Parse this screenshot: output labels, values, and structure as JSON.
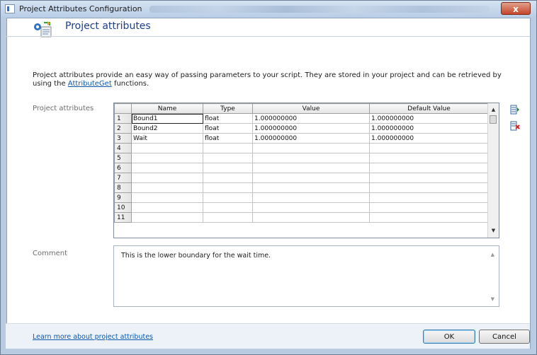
{
  "window": {
    "title": "Project Attributes Configuration",
    "close_glyph": "x"
  },
  "header": {
    "title": "Project attributes",
    "icon": "attributes-icon"
  },
  "description": {
    "text_before": "Project attributes provide an easy way of passing parameters to your script. They are stored in your project and can be retrieved by using the ",
    "link": "AttributeGet",
    "text_after": " functions."
  },
  "labels": {
    "attributes": "Project attributes",
    "comment": "Comment"
  },
  "grid": {
    "columns": [
      "Name",
      "Type",
      "Value",
      "Default Value"
    ],
    "rows": [
      {
        "num": "1",
        "name": "Bound1",
        "type": "float",
        "value": "1.000000000",
        "default": "1.000000000"
      },
      {
        "num": "2",
        "name": "Bound2",
        "type": "float",
        "value": "1.000000000",
        "default": "1.000000000"
      },
      {
        "num": "3",
        "name": "Wait",
        "type": "float",
        "value": "1.000000000",
        "default": "1.000000000"
      },
      {
        "num": "4",
        "name": "",
        "type": "",
        "value": "",
        "default": ""
      },
      {
        "num": "5",
        "name": "",
        "type": "",
        "value": "",
        "default": ""
      },
      {
        "num": "6",
        "name": "",
        "type": "",
        "value": "",
        "default": ""
      },
      {
        "num": "7",
        "name": "",
        "type": "",
        "value": "",
        "default": ""
      },
      {
        "num": "8",
        "name": "",
        "type": "",
        "value": "",
        "default": ""
      },
      {
        "num": "9",
        "name": "",
        "type": "",
        "value": "",
        "default": ""
      },
      {
        "num": "10",
        "name": "",
        "type": "",
        "value": "",
        "default": ""
      },
      {
        "num": "11",
        "name": "",
        "type": "",
        "value": "",
        "default": ""
      }
    ]
  },
  "side_icons": {
    "add": "add-row-icon",
    "delete": "delete-row-icon"
  },
  "comment": {
    "text": "This is the lower boundary for the wait time."
  },
  "footer": {
    "link": "Learn more about project attributes",
    "ok": "OK",
    "cancel": "Cancel"
  },
  "colors": {
    "accent": "#1e3d8f",
    "link": "#0d58a8",
    "delete": "#d92020",
    "frame": "#b9cbe0"
  }
}
